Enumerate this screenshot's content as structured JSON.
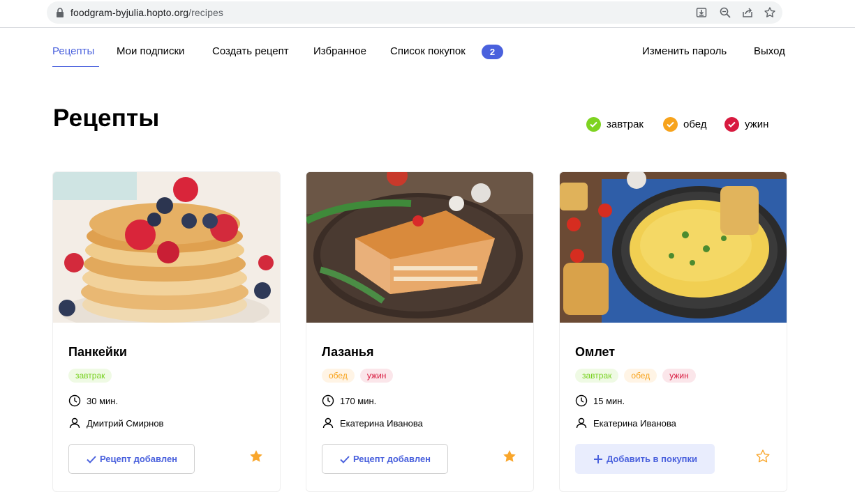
{
  "browser": {
    "url_host": "foodgram-byjulia.hopto.org",
    "url_path": "/recipes"
  },
  "nav": {
    "recipes": "Рецепты",
    "subscriptions": "Мои подписки",
    "create_recipe": "Создать рецепт",
    "favorites": "Избранное",
    "shopping_list": "Список покупок",
    "shopping_count": "2",
    "change_password": "Изменить пароль",
    "logout": "Выход"
  },
  "page": {
    "title": "Рецепты"
  },
  "filters": [
    {
      "label": "завтрак",
      "color": "#7ed321"
    },
    {
      "label": "обед",
      "color": "#f7a31c"
    },
    {
      "label": "ужин",
      "color": "#d81a3f"
    }
  ],
  "recipes": [
    {
      "title": "Панкейки",
      "tags": [
        "завтрак"
      ],
      "time": "30 мин.",
      "author": "Дмитрий Смирнов",
      "button": "Рецепт добавлен",
      "favorite": true
    },
    {
      "title": "Лазанья",
      "tags": [
        "обед",
        "ужин"
      ],
      "time": "170 мин.",
      "author": "Екатерина Иванова",
      "button": "Рецепт добавлен",
      "favorite": true
    },
    {
      "title": "Омлет",
      "tags": [
        "завтрак",
        "обед",
        "ужин"
      ],
      "time": "15 мин.",
      "author": "Екатерина Иванова",
      "button": "Добавить в покупки",
      "favorite": false
    }
  ],
  "colors": {
    "accent": "#4a61dd",
    "star": "#f9a62b"
  }
}
